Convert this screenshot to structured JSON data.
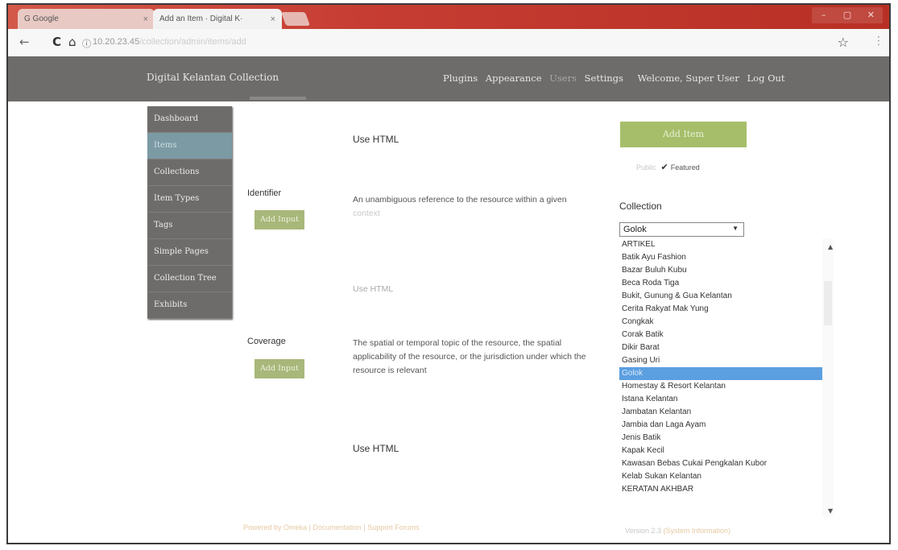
{
  "browser": {
    "tabs": [
      {
        "label": "G Google",
        "close": "×"
      },
      {
        "label": "Add an Item · Digital K·",
        "close": "×"
      }
    ],
    "url": "10.20.23.45",
    "url_rest": "/collection/admin/items/add",
    "window_buttons": [
      "–",
      "▢",
      "✕"
    ]
  },
  "adminbar": {
    "site_title": "Digital Kelantan Collection",
    "nav": {
      "plugins": "Plugins",
      "appearance": "Appearance",
      "users": "Users",
      "settings": "Settings",
      "welcome": "Welcome, Super User",
      "logout": "Log Out"
    }
  },
  "leftnav": {
    "items": [
      "Dashboard",
      "Items",
      "Collections",
      "Item Types",
      "Tags",
      "Simple Pages",
      "Collection Tree",
      "Exhibits"
    ]
  },
  "fields": {
    "use_html_top": "Use HTML",
    "identifier": {
      "label": "Identifier",
      "add_input": "Add Input",
      "desc_1": "An unambiguous reference to the resource within a given",
      "desc_2": "context",
      "use_html": "Use HTML"
    },
    "coverage": {
      "label": "Coverage",
      "add_input": "Add Input",
      "desc_1": "The spatial or temporal topic of the resource, the spatial",
      "desc_2": "applicability of the resource, or the jurisdiction under which the",
      "desc_3": "resource is relevant",
      "use_html": "Use HTML"
    }
  },
  "panel": {
    "add_item": "Add Item",
    "public_label": "Public",
    "featured_label": "Featured",
    "collection_label": "Collection",
    "collection_selected": "Golok",
    "collection_options": [
      "ARTIKEL",
      "Batik Ayu Fashion",
      "Bazar Buluh Kubu",
      "Beca Roda Tiga",
      "Bukit, Gunung & Gua Kelantan",
      "Cerita Rakyat Mak Yung",
      "Congkak",
      "Corak Batik",
      "Dikir Barat",
      "Gasing Uri",
      "Golok",
      "Homestay & Resort Kelantan",
      "Istana Kelantan",
      "Jambatan Kelantan",
      "Jambia dan Laga Ayam",
      "Jenis Batik",
      "Kapak Kecil",
      "Kawasan Bebas Cukai Pengkalan Kubor",
      "Kelab Sukan Kelantan",
      "KERATAN AKHBAR"
    ]
  },
  "footer": {
    "left": "Powered by Omeka | Documentation | Support Forums",
    "version": "Version 2.3",
    "version_link": "(System Information)"
  }
}
